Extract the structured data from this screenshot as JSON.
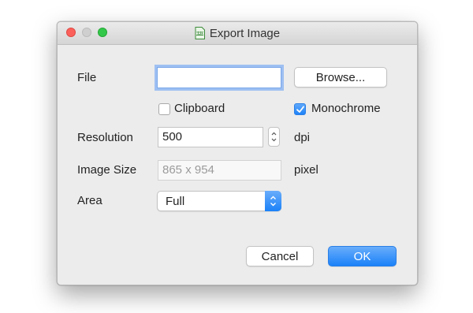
{
  "window": {
    "title": "Export Image",
    "icon": "brd-document-icon",
    "icon_text": "BRD"
  },
  "file": {
    "label": "File",
    "value": "",
    "browse_label": "Browse..."
  },
  "options": {
    "clipboard_label": "Clipboard",
    "clipboard_checked": false,
    "monochrome_label": "Monochrome",
    "monochrome_checked": true
  },
  "resolution": {
    "label": "Resolution",
    "value": "500",
    "unit": "dpi"
  },
  "image_size": {
    "label": "Image Size",
    "value": "865 x 954",
    "unit": "pixel"
  },
  "area": {
    "label": "Area",
    "selected": "Full"
  },
  "buttons": {
    "cancel": "Cancel",
    "ok": "OK"
  },
  "colors": {
    "accent": "#1b81f8",
    "close": "#fc605b",
    "maximize": "#34c84a"
  }
}
